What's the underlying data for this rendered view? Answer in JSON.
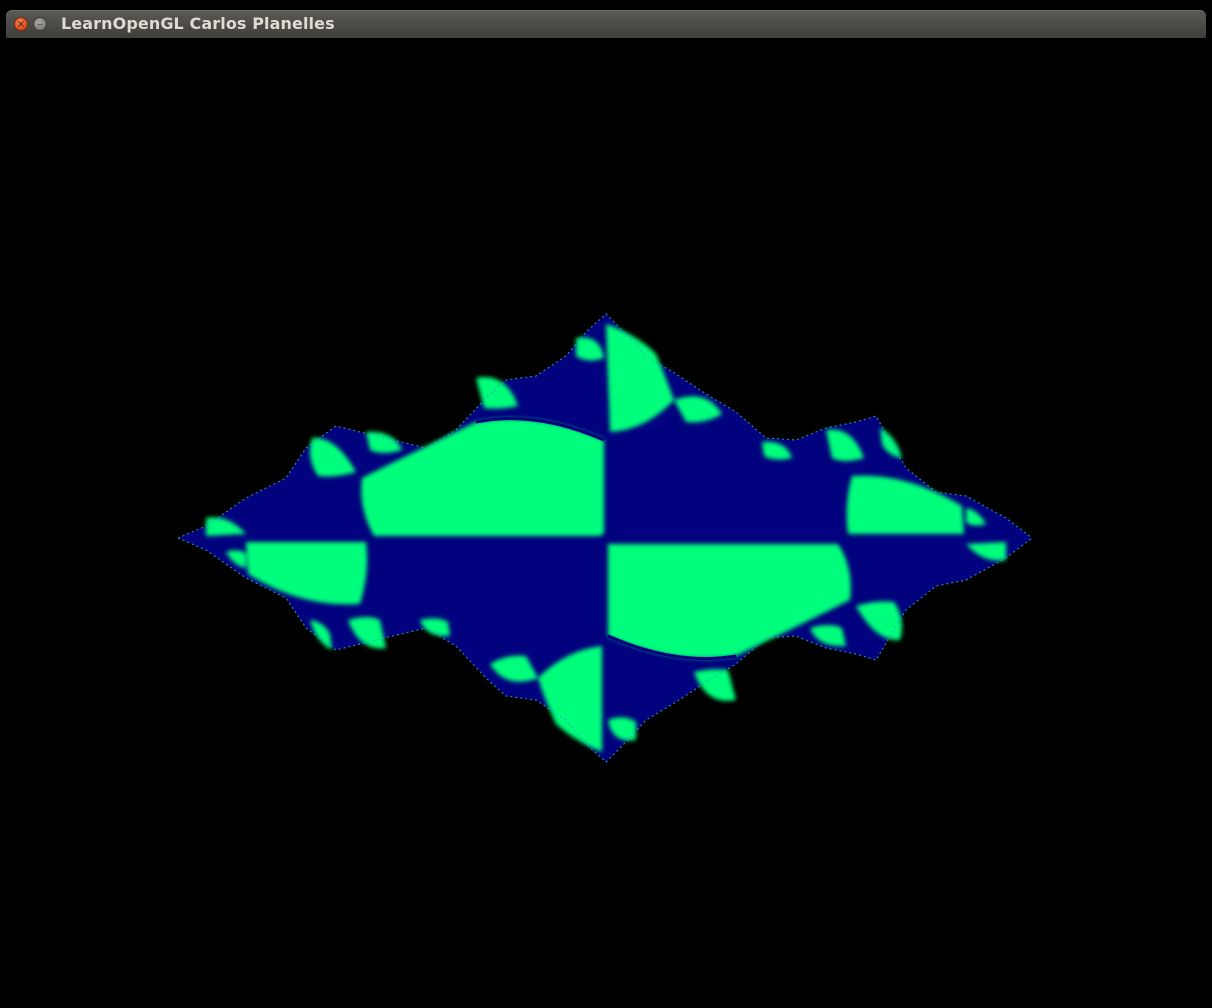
{
  "window": {
    "title": "LearnOpenGL Carlos Planelles",
    "close_icon": "close-icon",
    "minimize_icon": "minimize-icon",
    "close_glyph": "×",
    "minimize_glyph": "–"
  },
  "render": {
    "background_color": "#000000",
    "fractal_colors": {
      "dark": "#02027f",
      "light": "#00fe7c",
      "edge": "#2aa8c8"
    }
  }
}
